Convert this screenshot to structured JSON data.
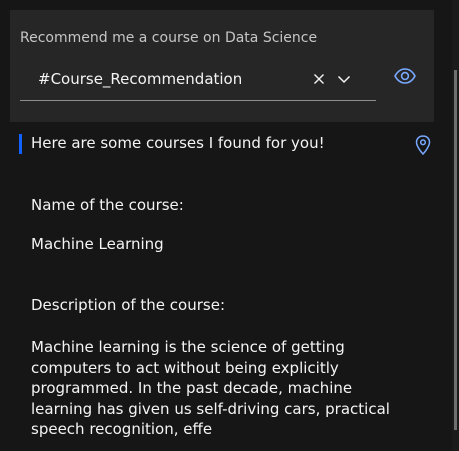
{
  "request": {
    "prompt": "Recommend me a course on Data Science",
    "intent_value": "#Course_Recommendation",
    "clear_icon": "close-icon",
    "dropdown_icon": "chevron-down-icon",
    "visibility_icon": "eye-icon"
  },
  "response": {
    "heading": "Here are some courses I found for you!",
    "pin_icon": "location-pin-icon",
    "name_label": "Name of the course:",
    "course_name": "Machine Learning",
    "description_label": "Description of the course:",
    "description": "Machine learning is the science of getting computers to act without being explicitly programmed. In the past decade, machine learning has given us self-driving cars, practical speech recognition, effe"
  },
  "colors": {
    "background": "#161616",
    "panel": "#262626",
    "accent": "#0f62fe",
    "icon_blue": "#78a9ff"
  }
}
